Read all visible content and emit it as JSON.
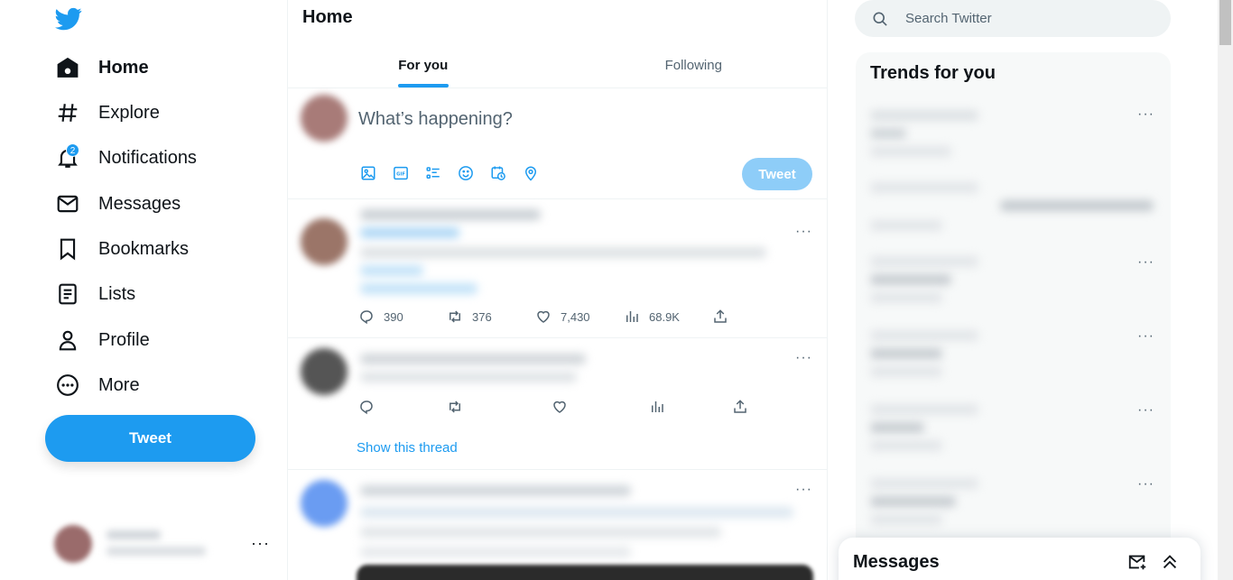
{
  "nav": {
    "items": [
      {
        "label": "Home",
        "icon": "home-icon"
      },
      {
        "label": "Explore",
        "icon": "hashtag-icon"
      },
      {
        "label": "Notifications",
        "icon": "bell-icon",
        "badge": "2"
      },
      {
        "label": "Messages",
        "icon": "envelope-icon"
      },
      {
        "label": "Bookmarks",
        "icon": "bookmark-icon"
      },
      {
        "label": "Lists",
        "icon": "list-icon"
      },
      {
        "label": "Profile",
        "icon": "person-icon"
      },
      {
        "label": "More",
        "icon": "more-circle-icon"
      }
    ],
    "tweet_button": "Tweet",
    "account_more": "···"
  },
  "main": {
    "title": "Home",
    "tabs": [
      {
        "label": "For you",
        "active": true
      },
      {
        "label": "Following",
        "active": false
      }
    ],
    "composer": {
      "placeholder": "What’s happening?",
      "tweet_button": "Tweet",
      "tools": [
        "image-icon",
        "gif-icon",
        "poll-icon",
        "emoji-icon",
        "schedule-icon",
        "location-icon"
      ]
    },
    "posts": [
      {
        "more": "···",
        "replies": "390",
        "retweets": "376",
        "likes": "7,430",
        "views": "68.9K"
      },
      {
        "more": "···",
        "replies": "",
        "retweets": "",
        "likes": "",
        "views": "",
        "show_thread": "Show this thread"
      },
      {
        "more": "···"
      }
    ]
  },
  "right": {
    "search": {
      "placeholder": "Search Twitter"
    },
    "trends_title": "Trends for you",
    "trend_more": "···"
  },
  "messages_drawer": {
    "title": "Messages"
  },
  "colors": {
    "accent": "#1d9bf0",
    "text": "#0f1419",
    "muted": "#536471",
    "border": "#eff3f4"
  }
}
